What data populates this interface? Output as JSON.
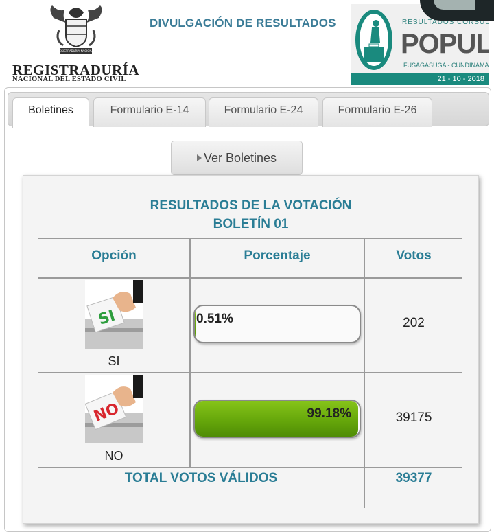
{
  "header": {
    "org_name": "REGISTRADURÍA",
    "org_subtitle": "NACIONAL DEL ESTADO CIVIL",
    "page_title": "DIVULGACIÓN DE RESULTADOS",
    "badge": {
      "small_text": "RESULTADOS CONSULTA",
      "big_text": "POPULAR",
      "place": "FUSAGASUGA - CUNDINAMARCA",
      "date": "21 - 10 - 2018"
    },
    "crest_emblem_text": "REGISTRADURIA NACIONAL"
  },
  "tabs": [
    {
      "label": "Boletines",
      "active": true
    },
    {
      "label": "Formulario E-14",
      "active": false
    },
    {
      "label": "Formulario E-24",
      "active": false
    },
    {
      "label": "Formulario E-26",
      "active": false
    }
  ],
  "ver_button": {
    "label": "Ver Boletines"
  },
  "results": {
    "title_line1": "RESULTADOS DE LA VOTACIÓN",
    "title_line2": "BOLETÍN 01",
    "columns": [
      "Opción",
      "Porcentaje",
      "Votos"
    ],
    "rows": [
      {
        "option": "SI",
        "ballot_text": "SI",
        "percent_value": 0.51,
        "percent_label": "0.51%",
        "votes": "202"
      },
      {
        "option": "NO",
        "ballot_text": "NO",
        "percent_value": 99.18,
        "percent_label": "99.18%",
        "votes": "39175"
      }
    ],
    "total_label": "TOTAL VOTOS VÁLIDOS",
    "total_votes": "39377"
  },
  "colors": {
    "accent": "#2a7d95",
    "bar_green": "#63a40a",
    "badge_teal": "#1a8a7e"
  }
}
